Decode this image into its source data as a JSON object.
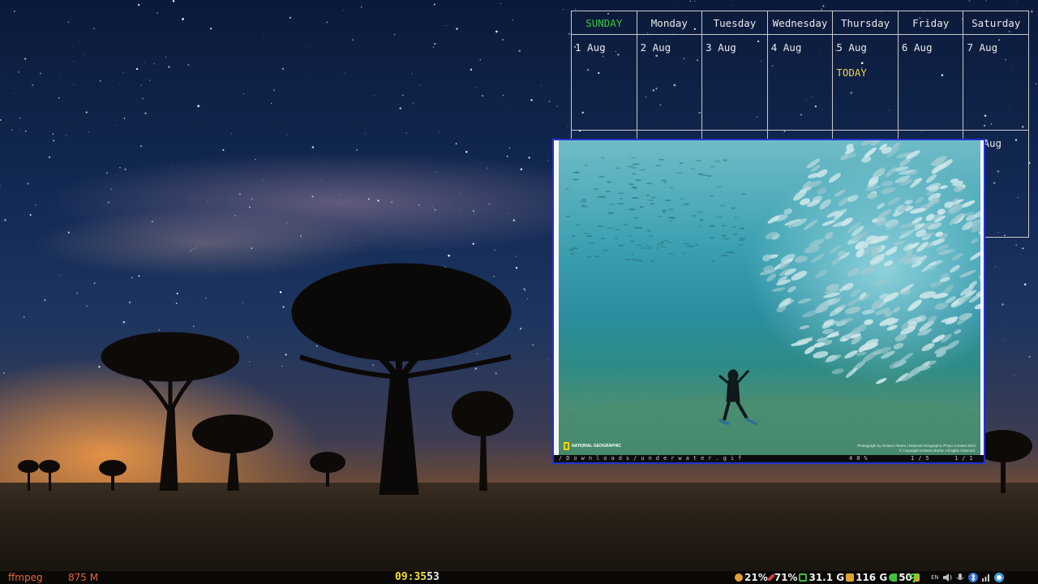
{
  "calendar": {
    "weekdays": [
      "SUNDAY",
      "Monday",
      "Tuesday",
      "Wednesday",
      "Thursday",
      "Friday",
      "Saturday"
    ],
    "week1": [
      "1 Aug",
      "2 Aug",
      "3 Aug",
      "4 Aug",
      "5 Aug",
      "6 Aug",
      "7 Aug"
    ],
    "week2_visible": "Aug",
    "today_label": "TODAY",
    "today_index": 4,
    "colors": {
      "sunday": "#35c835",
      "today": "#e8d24a",
      "grid": "#c9c9c9"
    }
  },
  "viewer": {
    "path": "/Downloads/underwater.gif",
    "zoom": "48%",
    "frame": "1/5",
    "file_index": "1/1",
    "border_color": "#2233cc",
    "watermark": "NATIONAL GEOGRAPHIC",
    "credit_line1": "Photograph by Octavio Aburto | National Geographic Photo Contest 2013",
    "credit_line2": "© Copyright Octavio Aburto. All rights reserved."
  },
  "taskbar": {
    "process": "ffmpeg",
    "process_mem": "875 M",
    "clock_hm": "09:35",
    "clock_sec": "53",
    "cpu": "21%",
    "battery": "71%",
    "mem_free": "31.1 G",
    "disk_free": "116 G",
    "volume": "50",
    "keyboard_layout": "EN",
    "colors": {
      "process": "#e8633a",
      "clock": "#f0e030"
    }
  }
}
